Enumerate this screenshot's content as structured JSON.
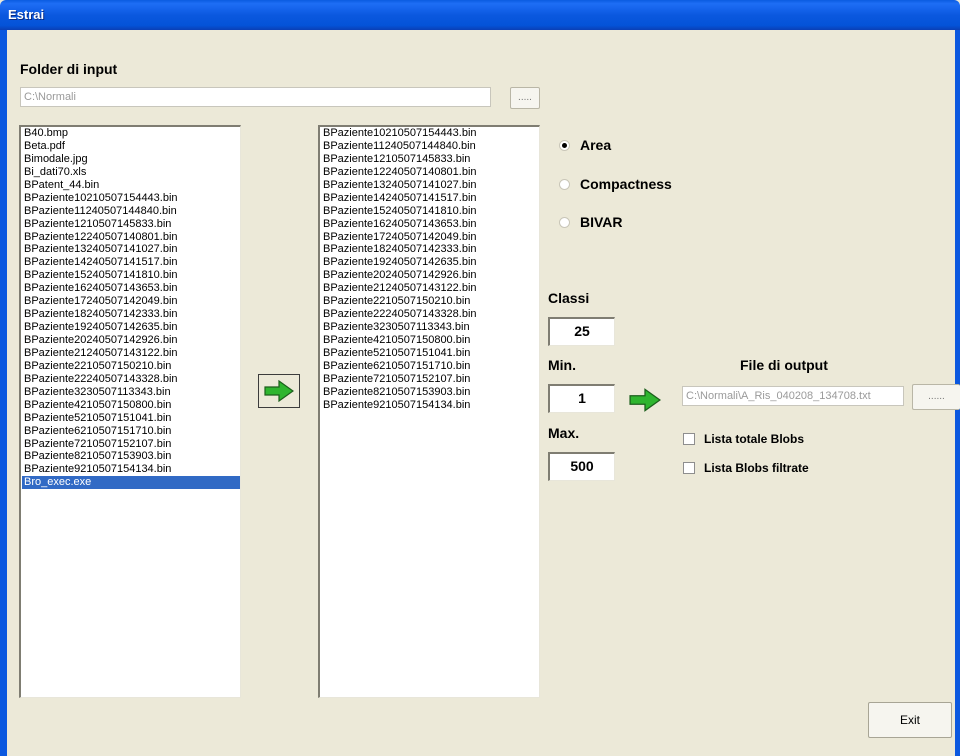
{
  "window": {
    "title": "Estrai"
  },
  "input_section": {
    "label": "Folder di input",
    "path": "C:\\Normali",
    "browse_label": "....."
  },
  "source_list": {
    "items": [
      "B40.bmp",
      "Beta.pdf",
      "Bimodale.jpg",
      "Bi_dati70.xls",
      "BPatent_44.bin",
      "BPaziente10210507154443.bin",
      "BPaziente11240507144840.bin",
      "BPaziente1210507145833.bin",
      "BPaziente12240507140801.bin",
      "BPaziente13240507141027.bin",
      "BPaziente14240507141517.bin",
      "BPaziente15240507141810.bin",
      "BPaziente16240507143653.bin",
      "BPaziente17240507142049.bin",
      "BPaziente18240507142333.bin",
      "BPaziente19240507142635.bin",
      "BPaziente20240507142926.bin",
      "BPaziente21240507143122.bin",
      "BPaziente2210507150210.bin",
      "BPaziente22240507143328.bin",
      "BPaziente3230507113343.bin",
      "BPaziente4210507150800.bin",
      "BPaziente5210507151041.bin",
      "BPaziente6210507151710.bin",
      "BPaziente7210507152107.bin",
      "BPaziente8210507153903.bin",
      "BPaziente9210507154134.bin",
      "Bro_exec.exe"
    ],
    "selected_index": 27
  },
  "filtered_list": {
    "items": [
      "BPaziente10210507154443.bin",
      "BPaziente11240507144840.bin",
      "BPaziente1210507145833.bin",
      "BPaziente12240507140801.bin",
      "BPaziente13240507141027.bin",
      "BPaziente14240507141517.bin",
      "BPaziente15240507141810.bin",
      "BPaziente16240507143653.bin",
      "BPaziente17240507142049.bin",
      "BPaziente18240507142333.bin",
      "BPaziente19240507142635.bin",
      "BPaziente20240507142926.bin",
      "BPaziente21240507143122.bin",
      "BPaziente2210507150210.bin",
      "BPaziente22240507143328.bin",
      "BPaziente3230507113343.bin",
      "BPaziente4210507150800.bin",
      "BPaziente5210507151041.bin",
      "BPaziente6210507151710.bin",
      "BPaziente7210507152107.bin",
      "BPaziente8210507153903.bin",
      "BPaziente9210507154134.bin"
    ]
  },
  "options": {
    "radios": [
      {
        "label": "Area",
        "checked": true
      },
      {
        "label": "Compactness",
        "checked": false
      },
      {
        "label": "BIVAR",
        "checked": false
      }
    ]
  },
  "params": {
    "classi_label": "Classi",
    "classi_value": "25",
    "min_label": "Min.",
    "min_value": "1",
    "max_label": "Max.",
    "max_value": "500"
  },
  "output": {
    "label": "File di output",
    "path": "C:\\Normali\\A_Ris_040208_134708.txt",
    "browse_label": "......",
    "checkboxes": [
      {
        "label": "Lista totale Blobs",
        "checked": false
      },
      {
        "label": "Lista Blobs filtrate",
        "checked": false
      }
    ]
  },
  "footer": {
    "exit_label": "Exit"
  },
  "colors": {
    "title_bar": "#0b58df",
    "selection": "#316ac5",
    "arrow_green": "#2fb52f"
  }
}
